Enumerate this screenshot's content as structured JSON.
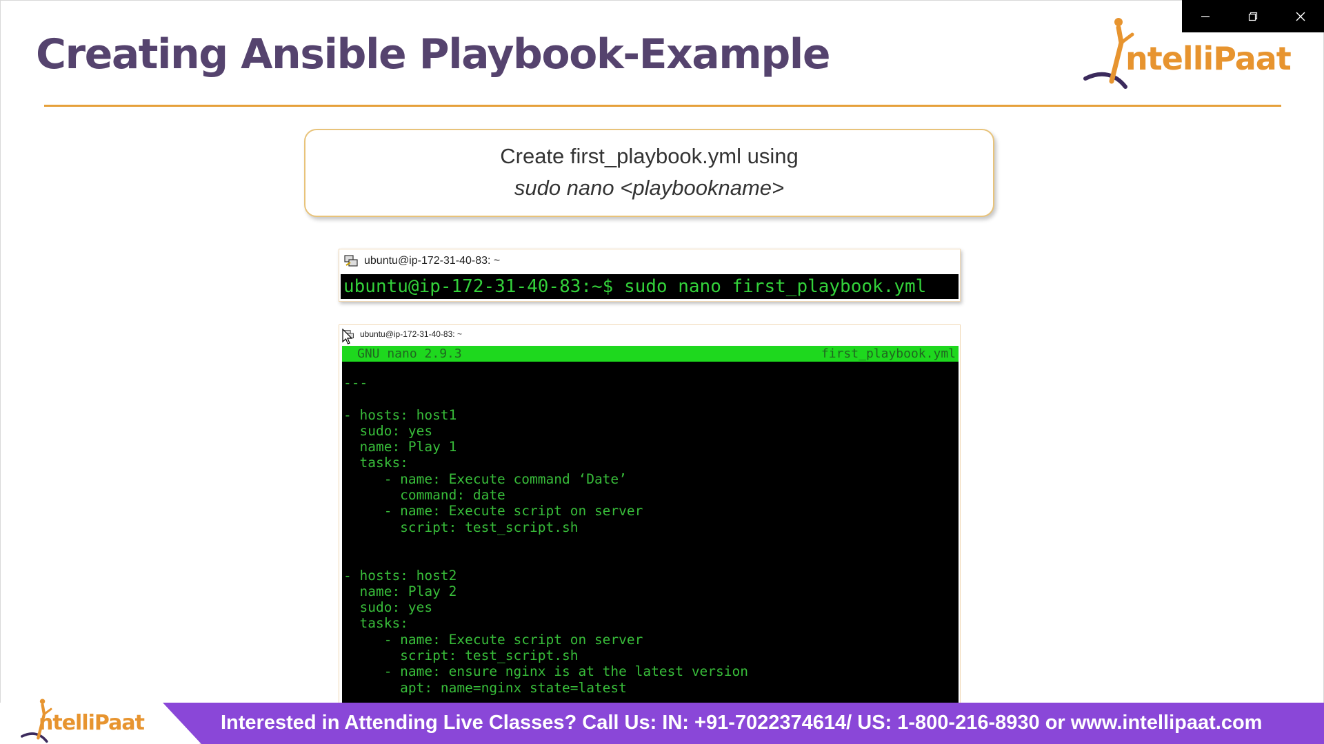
{
  "window": {
    "minimize_icon": "minimize-icon",
    "restore_icon": "restore-icon",
    "close_icon": "close-icon"
  },
  "slide": {
    "title": "Creating Ansible Playbook-Example",
    "brand": "ntelliPaat",
    "instruction_line1": "Create first_playbook.yml using",
    "instruction_line2": "sudo nano <playbookname>"
  },
  "terminal1": {
    "title": "ubuntu@ip-172-31-40-83: ~",
    "command": "ubuntu@ip-172-31-40-83:~$ sudo nano first_playbook.yml"
  },
  "terminal2": {
    "title": "ubuntu@ip-172-31-40-83: ~",
    "nano_version": "GNU nano 2.9.3",
    "filename": "first_playbook.yml",
    "content": "---\n\n- hosts: host1\n  sudo: yes\n  name: Play 1\n  tasks:\n     - name: Execute command ‘Date’\n       command: date\n     - name: Execute script on server\n       script: test_script.sh\n\n\n- hosts: host2\n  name: Play 2\n  sudo: yes\n  tasks:\n     - name: Execute script on server\n       script: test_script.sh\n     - name: ensure nginx is at the latest version\n       apt: name=nginx state=latest"
  },
  "footer": {
    "brand": "ntelliPaat",
    "text": "Interested in Attending Live Classes? Call Us: IN: +91-7022374614/ US: 1-800-216-8930 or www.intellipaat.com"
  },
  "colors": {
    "title": "#55436e",
    "accent": "#e6a03a",
    "terminal_green": "#38bd3a",
    "nano_bar": "#1ed81e",
    "footer_band": "#8a47d8"
  }
}
